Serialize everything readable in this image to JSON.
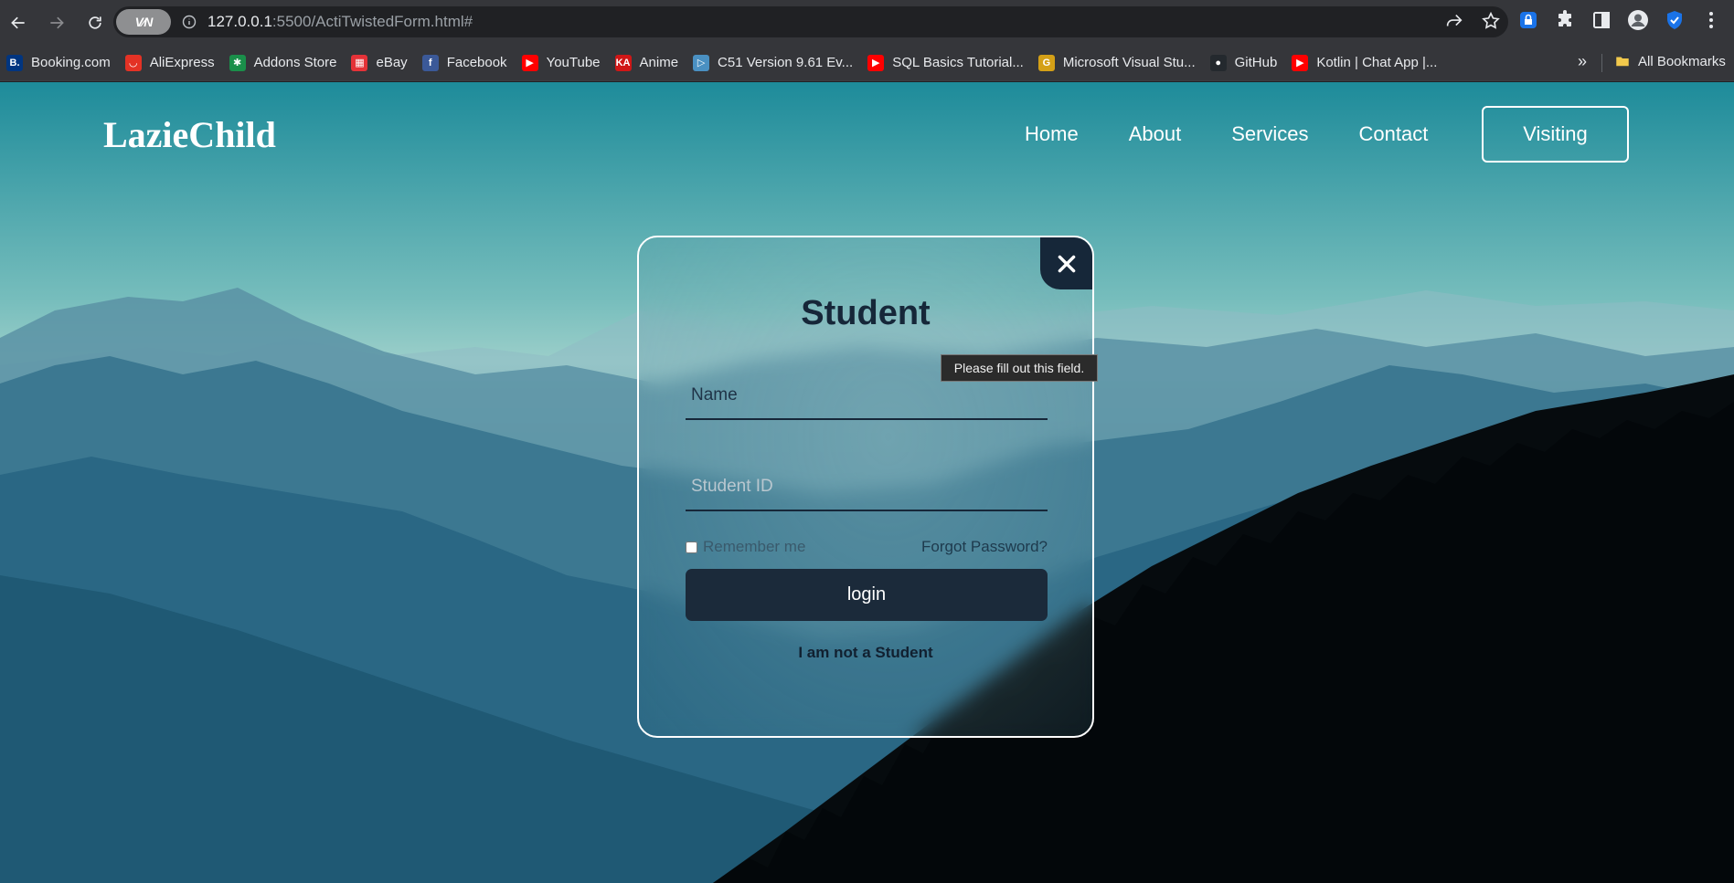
{
  "browser": {
    "url_host": "127.0.0.1",
    "url_rest": ":5500/ActiTwistedForm.html#",
    "vpn_label": "V∕N",
    "bookmarks": [
      {
        "label": "Booking.com",
        "icon": "booking-icon",
        "color": "#003580",
        "glyph": "B."
      },
      {
        "label": "AliExpress",
        "icon": "aliexpress-icon",
        "color": "#e43225",
        "glyph": "◡"
      },
      {
        "label": "Addons Store",
        "icon": "addons-icon",
        "color": "#1a8f4a",
        "glyph": "✱"
      },
      {
        "label": "eBay",
        "icon": "ebay-icon",
        "color": "#e53238",
        "glyph": "▦"
      },
      {
        "label": "Facebook",
        "icon": "facebook-icon",
        "color": "#3b5998",
        "glyph": "f"
      },
      {
        "label": "YouTube",
        "icon": "youtube-icon",
        "color": "#ff0000",
        "glyph": "▶"
      },
      {
        "label": "Anime",
        "icon": "anime-icon",
        "color": "#d01717",
        "glyph": "KA"
      },
      {
        "label": "C51 Version 9.61 Ev...",
        "icon": "c51-icon",
        "color": "#4a90c2",
        "glyph": "▷"
      },
      {
        "label": "SQL Basics Tutorial...",
        "icon": "youtube-icon",
        "color": "#ff0000",
        "glyph": "▶"
      },
      {
        "label": "Microsoft Visual Stu...",
        "icon": "google-icon",
        "color": "#d4a017",
        "glyph": "G"
      },
      {
        "label": "GitHub",
        "icon": "github-icon",
        "color": "#24292e",
        "glyph": "●"
      },
      {
        "label": "Kotlin | Chat App |...",
        "icon": "youtube-icon",
        "color": "#ff0000",
        "glyph": "▶"
      }
    ],
    "more_label": "»",
    "all_bookmarks_label": "All Bookmarks"
  },
  "site": {
    "logo": "LazieChild",
    "nav": [
      "Home",
      "About",
      "Services",
      "Contact"
    ],
    "visiting_label": "Visiting"
  },
  "modal": {
    "title": "Student",
    "name_placeholder": "Name",
    "id_placeholder": "Student ID",
    "remember_label": "Remember me",
    "forgot_label": "Forgot Password?",
    "login_label": "login",
    "not_student_label": "I am not a Student",
    "close_icon": "close-icon"
  },
  "tooltip": "Please fill out this field.",
  "colors": {
    "modal_dark": "#162739",
    "chrome_bg": "#35363a",
    "omnibox_bg": "#202124"
  }
}
